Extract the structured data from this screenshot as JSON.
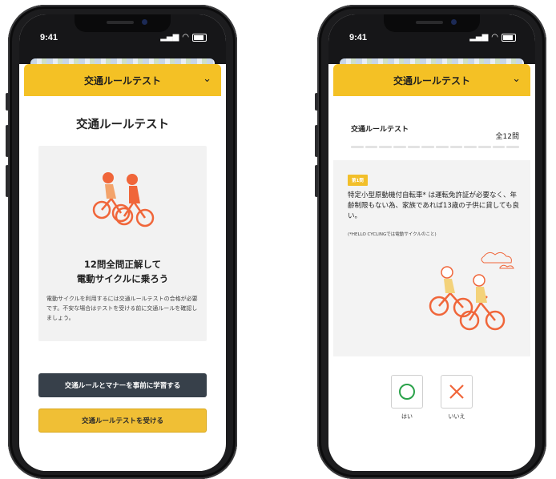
{
  "left_phone": {
    "status": {
      "time": "9:41"
    },
    "header": {
      "title": "交通ルールテスト"
    },
    "page_title": "交通ルールテスト",
    "card": {
      "headline_1": "12問全問正解して",
      "headline_2": "電動サイクルに乗ろう",
      "description": "電動サイクルを利用するには交通ルールテストの合格が必要です。不安な場合はテストを受ける前に交通ルールを確認しましょう。"
    },
    "buttons": {
      "learn": "交通ルールとマナーを事前に学習する",
      "take_test": "交通ルールテストを受ける"
    }
  },
  "right_phone": {
    "status": {
      "time": "9:41"
    },
    "header": {
      "title": "交通ルールテスト"
    },
    "quiz_title": "交通ルールテスト",
    "question_count": "全12問",
    "progress": {
      "total": 12,
      "answered": 0
    },
    "question": {
      "badge": "第1問",
      "text": "特定小型原動機付自転車* は運転免許証が必要なく、年齢制限もない為、家族であれば13歳の子供に貸しても良い。",
      "note": "(*HELLO CYCLINGでは電動サイクルのこと)"
    },
    "answers": {
      "yes": "はい",
      "no": "いいえ"
    }
  },
  "colors": {
    "accent_yellow": "#f4c125",
    "dark_button": "#37404a",
    "illustration_orange": "#f0663a"
  }
}
